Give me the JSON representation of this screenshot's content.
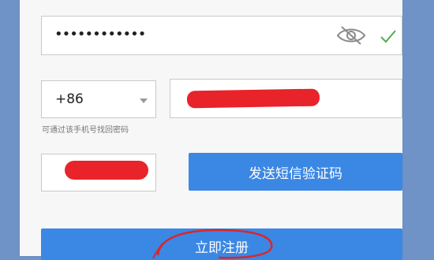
{
  "password": {
    "masked_value": "••••••••••••"
  },
  "country_code": {
    "value": "+86"
  },
  "phone_hint": "可通过该手机号找回密码",
  "send_sms_button": "发送短信验证码",
  "register_button": "立即注册",
  "colors": {
    "accent": "#3b87e4",
    "redaction": "#e8232a",
    "background": "#6f93c6",
    "check": "#4caf50"
  }
}
